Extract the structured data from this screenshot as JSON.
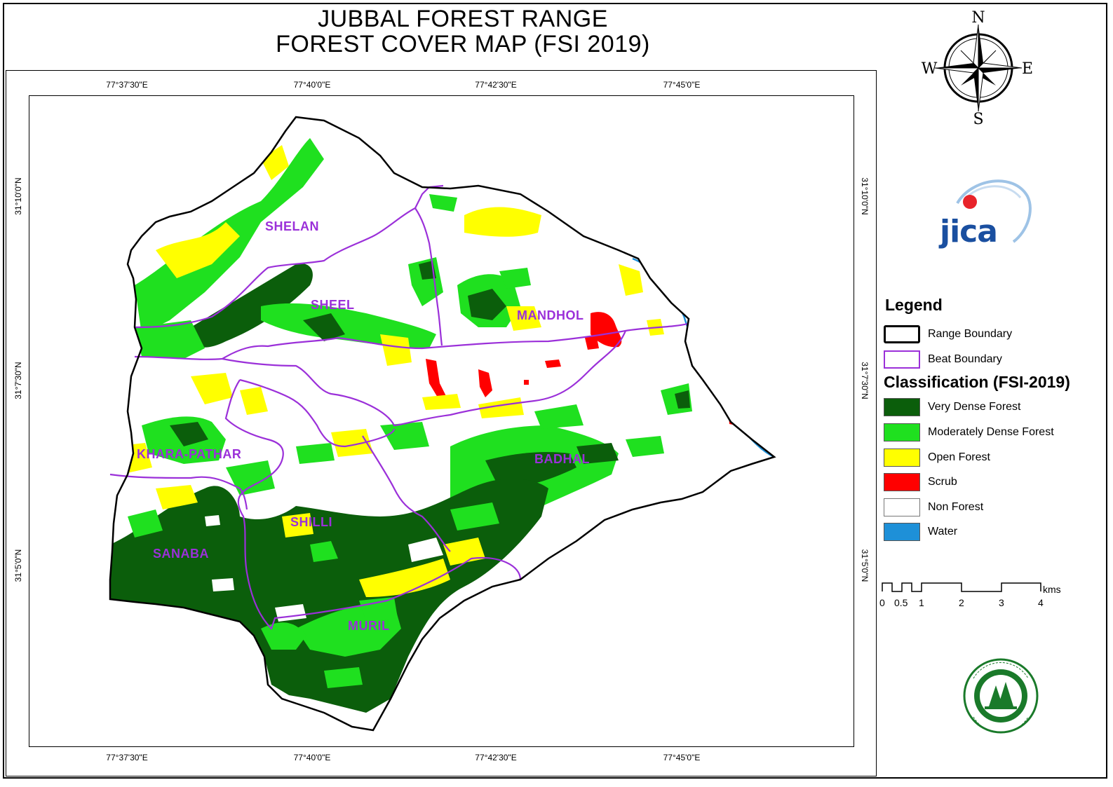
{
  "title": {
    "line1": "JUBBAL FOREST RANGE",
    "line2": "FOREST COVER MAP (FSI 2019)"
  },
  "grid": {
    "longitudes": [
      "77°37'30\"E",
      "77°40'0\"E",
      "77°42'30\"E",
      "77°45'0\"E"
    ],
    "latitudes": [
      "31°10'0\"N",
      "31°7'30\"N",
      "31°5'0\"N"
    ]
  },
  "compass": {
    "n": "N",
    "s": "S",
    "e": "E",
    "w": "W"
  },
  "beats": [
    "SHELAN",
    "SHEEL",
    "MANDHOL",
    "KHARA-PATHAR",
    "BADHAL",
    "SHILLI",
    "SANABA",
    "MURIL"
  ],
  "legend": {
    "title": "Legend",
    "boundaries": [
      {
        "label": "Range Boundary",
        "color": "#000000"
      },
      {
        "label": "Beat Boundary",
        "color": "#9b30d9"
      }
    ],
    "classification_title": "Classification (FSI-2019)",
    "classes": [
      {
        "label": "Very Dense Forest",
        "color": "#0b5e0b"
      },
      {
        "label": "Moderately Dense Forest",
        "color": "#1fe01f"
      },
      {
        "label": "Open Forest",
        "color": "#ffff00"
      },
      {
        "label": "Scrub",
        "color": "#ff0000"
      },
      {
        "label": "Non Forest",
        "color": "#ffffff"
      },
      {
        "label": "Water",
        "color": "#1e90d8"
      }
    ]
  },
  "scale_bar": {
    "unit": "kms",
    "labels": [
      "0",
      "0.5",
      "1",
      "2",
      "3",
      "4"
    ]
  },
  "logos": {
    "jica": "JICA",
    "department": "forest-department-emblem"
  }
}
